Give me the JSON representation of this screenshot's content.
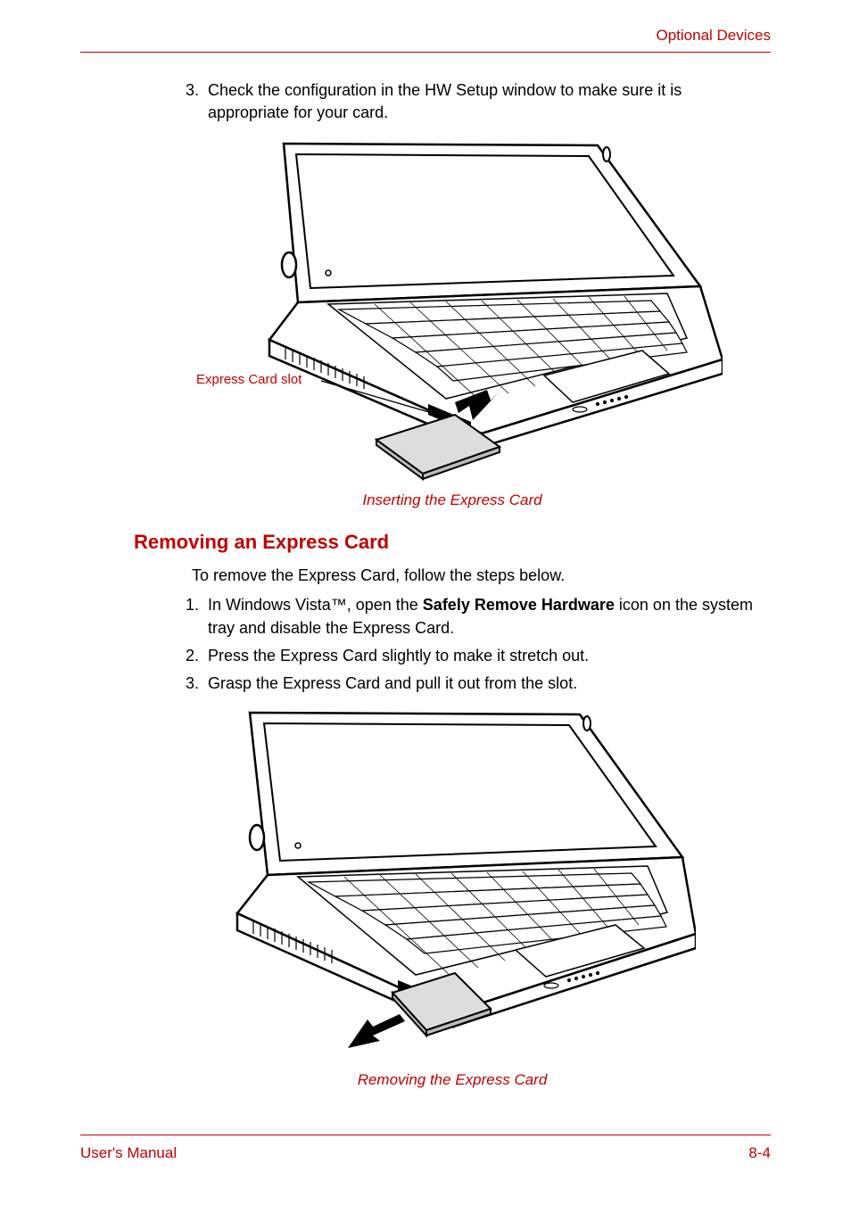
{
  "header": {
    "right_label": "Optional Devices"
  },
  "top_steps": {
    "items": [
      {
        "num": "3.",
        "text": "Check the configuration in the HW Setup window to make sure it is appropriate for your card."
      }
    ]
  },
  "figure1": {
    "callout": "Express Card slot",
    "caption": "Inserting the Express Card"
  },
  "section": {
    "heading": "Removing an Express Card",
    "intro": "To remove the Express Card, follow the steps below."
  },
  "remove_steps": {
    "items": [
      {
        "num": "1.",
        "prefix": "In Windows Vista™, open the ",
        "bold": "Safely Remove Hardware",
        "suffix": " icon on the system tray and disable the Express Card."
      },
      {
        "num": "2.",
        "prefix": "Press the Express Card slightly to make it stretch out.",
        "bold": "",
        "suffix": ""
      },
      {
        "num": "3.",
        "prefix": "Grasp the Express Card and pull it out from the slot.",
        "bold": "",
        "suffix": ""
      }
    ]
  },
  "figure2": {
    "caption": "Removing the Express Card"
  },
  "footer": {
    "left": "User's Manual",
    "right": "8-4"
  }
}
